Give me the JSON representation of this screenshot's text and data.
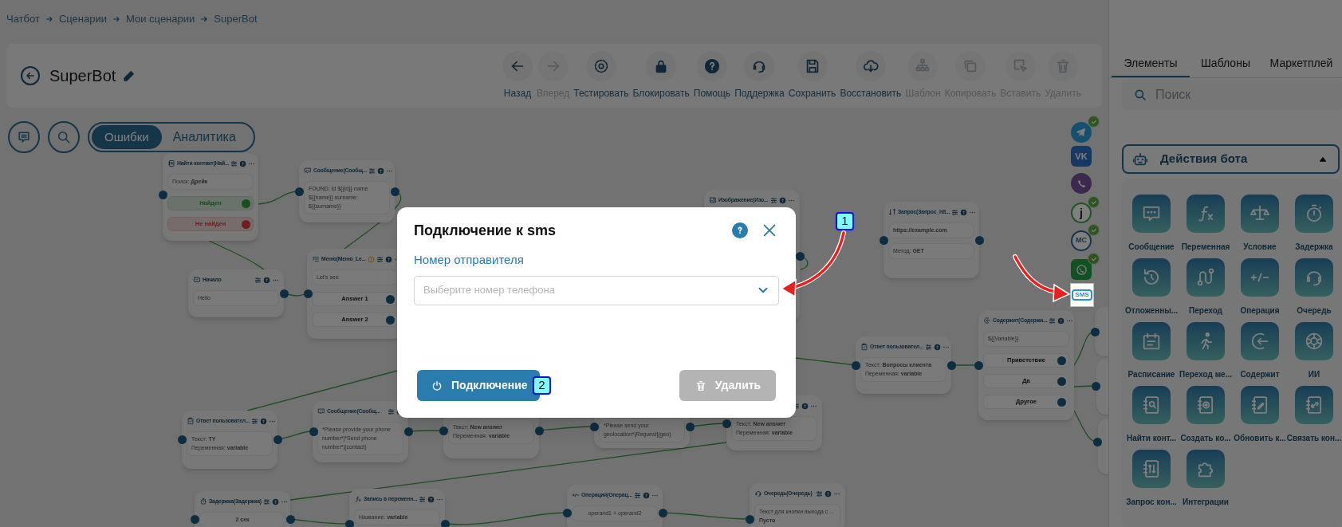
{
  "breadcrumbs": [
    "Чатбот",
    "Сценарии",
    "Мои сценарии",
    "SuperBot"
  ],
  "header": {
    "title": "SuperBot"
  },
  "toolbar": [
    {
      "kind": "back",
      "label": "Назад",
      "disabled": false
    },
    {
      "kind": "forward",
      "label": "Вперед",
      "disabled": true
    },
    {
      "kind": "test",
      "label": "Тестировать",
      "disabled": false
    },
    {
      "kind": "lock",
      "label": "Блокировать",
      "disabled": false
    },
    {
      "kind": "help",
      "label": "Помощь",
      "disabled": false
    },
    {
      "kind": "support",
      "label": "Поддержка",
      "disabled": false
    },
    {
      "kind": "save",
      "label": "Сохранить",
      "disabled": false
    },
    {
      "kind": "restore",
      "label": "Восстановить",
      "disabled": false
    },
    {
      "kind": "template",
      "label": "Шаблон",
      "disabled": true
    },
    {
      "kind": "copy",
      "label": "Копировать",
      "disabled": true
    },
    {
      "kind": "paste",
      "label": "Вставить",
      "disabled": true
    },
    {
      "kind": "delete",
      "label": "Удалить",
      "disabled": true
    }
  ],
  "view_toggle": [
    {
      "label": "Ошибки",
      "selected": true
    },
    {
      "label": "Аналитика",
      "selected": false
    }
  ],
  "nodes": [
    {
      "kind": "find",
      "title": "Найти контакт(Най...",
      "warning": false,
      "fields": [
        {
          "kind": "text",
          "lines": [
            "Поиск: **Дрейк**"
          ]
        }
      ],
      "outputs": [
        {
          "label": "Найден",
          "kind": "success"
        },
        {
          "label": "Не найден",
          "kind": "failure"
        }
      ]
    },
    {
      "kind": "message",
      "title": "Сообщение(Сообщ...",
      "warning": false,
      "fields": [
        {
          "kind": "text",
          "lines": [
            "FOUND: id ${{id}} name",
            "${{name}} surname:",
            "${{surname}}"
          ]
        }
      ]
    },
    {
      "kind": "image",
      "title": "Изображение(Изо...",
      "warning": false
    },
    {
      "kind": "request",
      "title": "Запрос(Запрос_htt...",
      "warning": false,
      "fields": [
        {
          "kind": "url",
          "lines": [
            "https://example.com"
          ]
        },
        {
          "kind": "text",
          "lines": [
            "Метод: **GET**"
          ]
        }
      ]
    },
    {
      "kind": "start",
      "title": "Начало",
      "warning": false,
      "fields": [
        {
          "kind": "text",
          "lines": [
            "Hello"
          ]
        }
      ]
    },
    {
      "kind": "menu",
      "title": "Меню(Меню_Le...",
      "warning": true,
      "fields": [
        {
          "kind": "text",
          "lines": [
            "Let's see"
          ]
        }
      ],
      "outputs": [
        {
          "label": "Answer 1",
          "kind": "default"
        },
        {
          "label": "Answer 2",
          "kind": "default"
        }
      ]
    },
    {
      "kind": "answer",
      "title": "Ответ пользовател...",
      "warning": false,
      "fields": [
        {
          "kind": "text",
          "lines": [
            "Текст: **Вопросы клиента**",
            "Переменная: **variable**"
          ]
        }
      ]
    },
    {
      "kind": "contains",
      "title": "Содержит(Содержи...",
      "warning": false,
      "fields": [
        {
          "kind": "text",
          "lines": [
            "${{Variable}}"
          ]
        }
      ],
      "outputs": [
        {
          "label": "Приветствие",
          "kind": "default"
        },
        {
          "label": "Да",
          "kind": "default"
        },
        {
          "label": "Другое",
          "kind": "default"
        }
      ]
    },
    {
      "kind": "answer",
      "title": "Ответ пользовател...",
      "warning": false,
      "fields": [
        {
          "kind": "text",
          "lines": [
            "Текст: **TY**",
            "Переменная: **variable**"
          ]
        }
      ]
    },
    {
      "kind": "message",
      "title": "Сообщение(Сообщ...",
      "warning": false,
      "fields": [
        {
          "kind": "text",
          "lines": [
            "*Please provide your phone",
            "number*|*Send phone",
            "number*|(contact)"
          ]
        }
      ]
    },
    {
      "fields": [
        {
          "kind": "text",
          "lines": [
            "Текст: **New answer**",
            "Переменная: **variable**"
          ]
        }
      ]
    },
    {
      "fields": [
        {
          "kind": "text",
          "lines": [
            "*Please send your",
            "geolocation*|*Request*|(geo)"
          ]
        }
      ]
    },
    {
      "fields": [
        {
          "kind": "text",
          "lines": [
            "Текст: **New answer**",
            "Переменная: **variable**"
          ]
        }
      ]
    },
    {
      "kind": "delay",
      "title": "Задержка(Задержка)",
      "warning": false,
      "fields": [
        {
          "kind": "value",
          "lines": [
            "2 сек"
          ]
        }
      ]
    },
    {
      "kind": "variable",
      "title": "Запись в переменн...",
      "warning": false,
      "fields": [
        {
          "kind": "text",
          "lines": [
            "Название: **variable**"
          ]
        }
      ]
    },
    {
      "kind": "operation",
      "title": "Операция(Операц...",
      "warning": false,
      "fields": [
        {
          "kind": "formula",
          "lines": [
            "operand1 + operand2"
          ]
        }
      ]
    },
    {
      "kind": "queue",
      "title": "Очередь(Очередь)",
      "warning": false,
      "fields": [
        {
          "kind": "text",
          "lines": [
            "Текст для кнопки выхода с ...",
            "**Пусто**"
          ]
        }
      ]
    }
  ],
  "channels": [
    {
      "kind": "telegram",
      "connected": true,
      "selected": false
    },
    {
      "kind": "vk",
      "label": "VK",
      "connected": false,
      "selected": false
    },
    {
      "kind": "viber",
      "connected": false,
      "selected": false
    },
    {
      "kind": "jivo",
      "label": "j",
      "connected": true,
      "selected": false
    },
    {
      "kind": "mc",
      "label": "MC",
      "connected": true,
      "selected": false
    },
    {
      "kind": "whatsapp",
      "connected": true,
      "selected": false
    },
    {
      "kind": "sms",
      "label": "SMS",
      "connected": false,
      "selected": true
    }
  ],
  "modal": {
    "title": "Подключение к sms",
    "field_label": "Номер отправителя",
    "select": {
      "placeholder": "Выберите номер телефона"
    },
    "connect_button": "Подключение",
    "delete_button": {
      "label": "Удалить",
      "disabled": true
    }
  },
  "annotations": [
    {
      "label": "1"
    },
    {
      "label": "2"
    }
  ],
  "sidebar": {
    "tabs": [
      {
        "label": "Элементы",
        "selected": true
      },
      {
        "label": "Шаблоны",
        "selected": false
      },
      {
        "label": "Маркетплей",
        "selected": false
      }
    ],
    "search": {
      "placeholder": "Поиск"
    },
    "section": {
      "title": "Действия бота",
      "expanded": true
    },
    "elements": [
      {
        "kind": "message",
        "label": "Сообщение"
      },
      {
        "kind": "variable",
        "label": "Переменная"
      },
      {
        "kind": "condition",
        "label": "Условие"
      },
      {
        "kind": "delay",
        "label": "Задержка"
      },
      {
        "kind": "deferred",
        "label": "Отложенны..."
      },
      {
        "kind": "transition",
        "label": "Переход"
      },
      {
        "kind": "operation",
        "label": "Операция"
      },
      {
        "kind": "queue",
        "label": "Очередь"
      },
      {
        "kind": "schedule",
        "label": "Расписание"
      },
      {
        "kind": "jump",
        "label": "Переход ме..."
      },
      {
        "kind": "contains",
        "label": "Содержит"
      },
      {
        "kind": "ai",
        "label": "ИИ"
      },
      {
        "kind": "find_contact",
        "label": "Найти конт..."
      },
      {
        "kind": "create_contact",
        "label": "Создать ко..."
      },
      {
        "kind": "update_contact",
        "label": "Обновить к..."
      },
      {
        "kind": "link_contact",
        "label": "Связать кон..."
      },
      {
        "kind": "request_contact",
        "label": "Запрос кон..."
      },
      {
        "kind": "integrations",
        "label": "Интеграции"
      }
    ]
  }
}
